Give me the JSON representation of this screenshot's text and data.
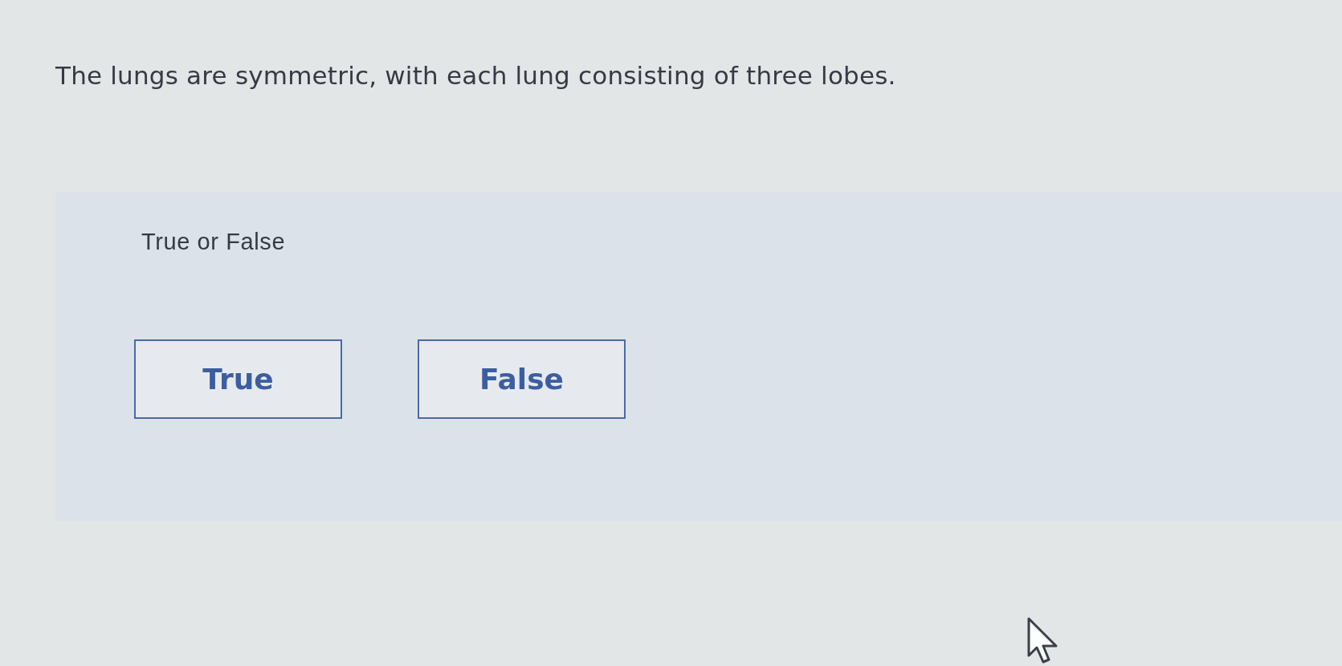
{
  "question": {
    "text": "The lungs are symmetric, with each lung consisting of three lobes."
  },
  "answer_panel": {
    "prompt": "True or False",
    "choices": [
      {
        "label": "True",
        "selected": false
      },
      {
        "label": "False",
        "selected": false
      }
    ]
  }
}
